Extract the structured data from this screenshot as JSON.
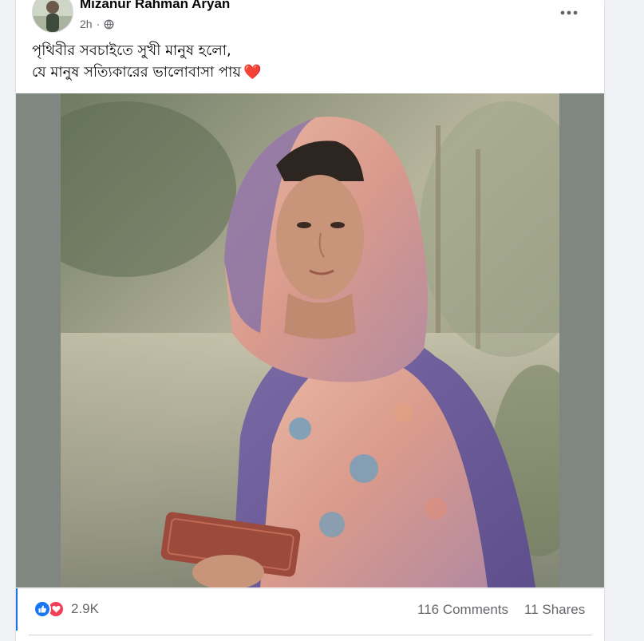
{
  "post": {
    "author": "Mizanur Rahman Aryan",
    "time": "2h",
    "separator": "·",
    "audience_icon": "globe-icon",
    "more_icon": "more-options-icon",
    "text_line1": "পৃথিবীর সবচাইতে সুখী মানুষ হলো,",
    "text_line2": "যে মানুষ সত্যিকারের ভালোবাসা পায়",
    "emoji": "❤️"
  },
  "engagement": {
    "reaction_icons": [
      "like-icon",
      "love-icon"
    ],
    "reactions_count": "2.9K",
    "comments": "116 Comments",
    "shares": "11 Shares"
  },
  "colors": {
    "like": "#1877f2",
    "love": "#f33e58",
    "secondary_text": "#65676b",
    "background": "#f0f2f5"
  }
}
